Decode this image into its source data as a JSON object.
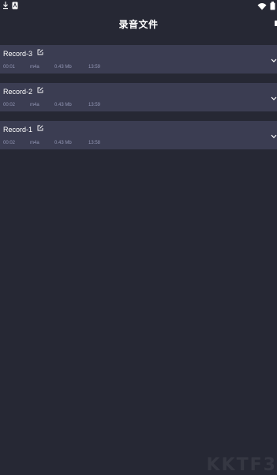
{
  "status_bar": {
    "left_icons": [
      "download-icon",
      "notification-icon"
    ],
    "right_icons": [
      "wifi-icon",
      "battery-icon"
    ]
  },
  "header": {
    "title": "录音文件",
    "right_icon": "more-icon"
  },
  "recordings": [
    {
      "name": "Record-3",
      "duration": "00:01",
      "format": "m4a",
      "size": "0.43 Mb",
      "time": "13:59",
      "icons": [
        "edit-icon",
        "chevron-down-icon"
      ]
    },
    {
      "name": "Record-2",
      "duration": "00:02",
      "format": "m4a",
      "size": "0.43 Mb",
      "time": "13:59",
      "icons": [
        "edit-icon",
        "chevron-down-icon"
      ]
    },
    {
      "name": "Record-1",
      "duration": "00:02",
      "format": "m4a",
      "size": "0.43 Mb",
      "time": "13:58",
      "icons": [
        "edit-icon",
        "chevron-down-icon"
      ]
    }
  ],
  "colors": {
    "background": "#262834",
    "row_background": "#3b3d52",
    "meta_text": "#9296b4",
    "primary_text": "#ffffff"
  },
  "watermark": "KKTF3"
}
